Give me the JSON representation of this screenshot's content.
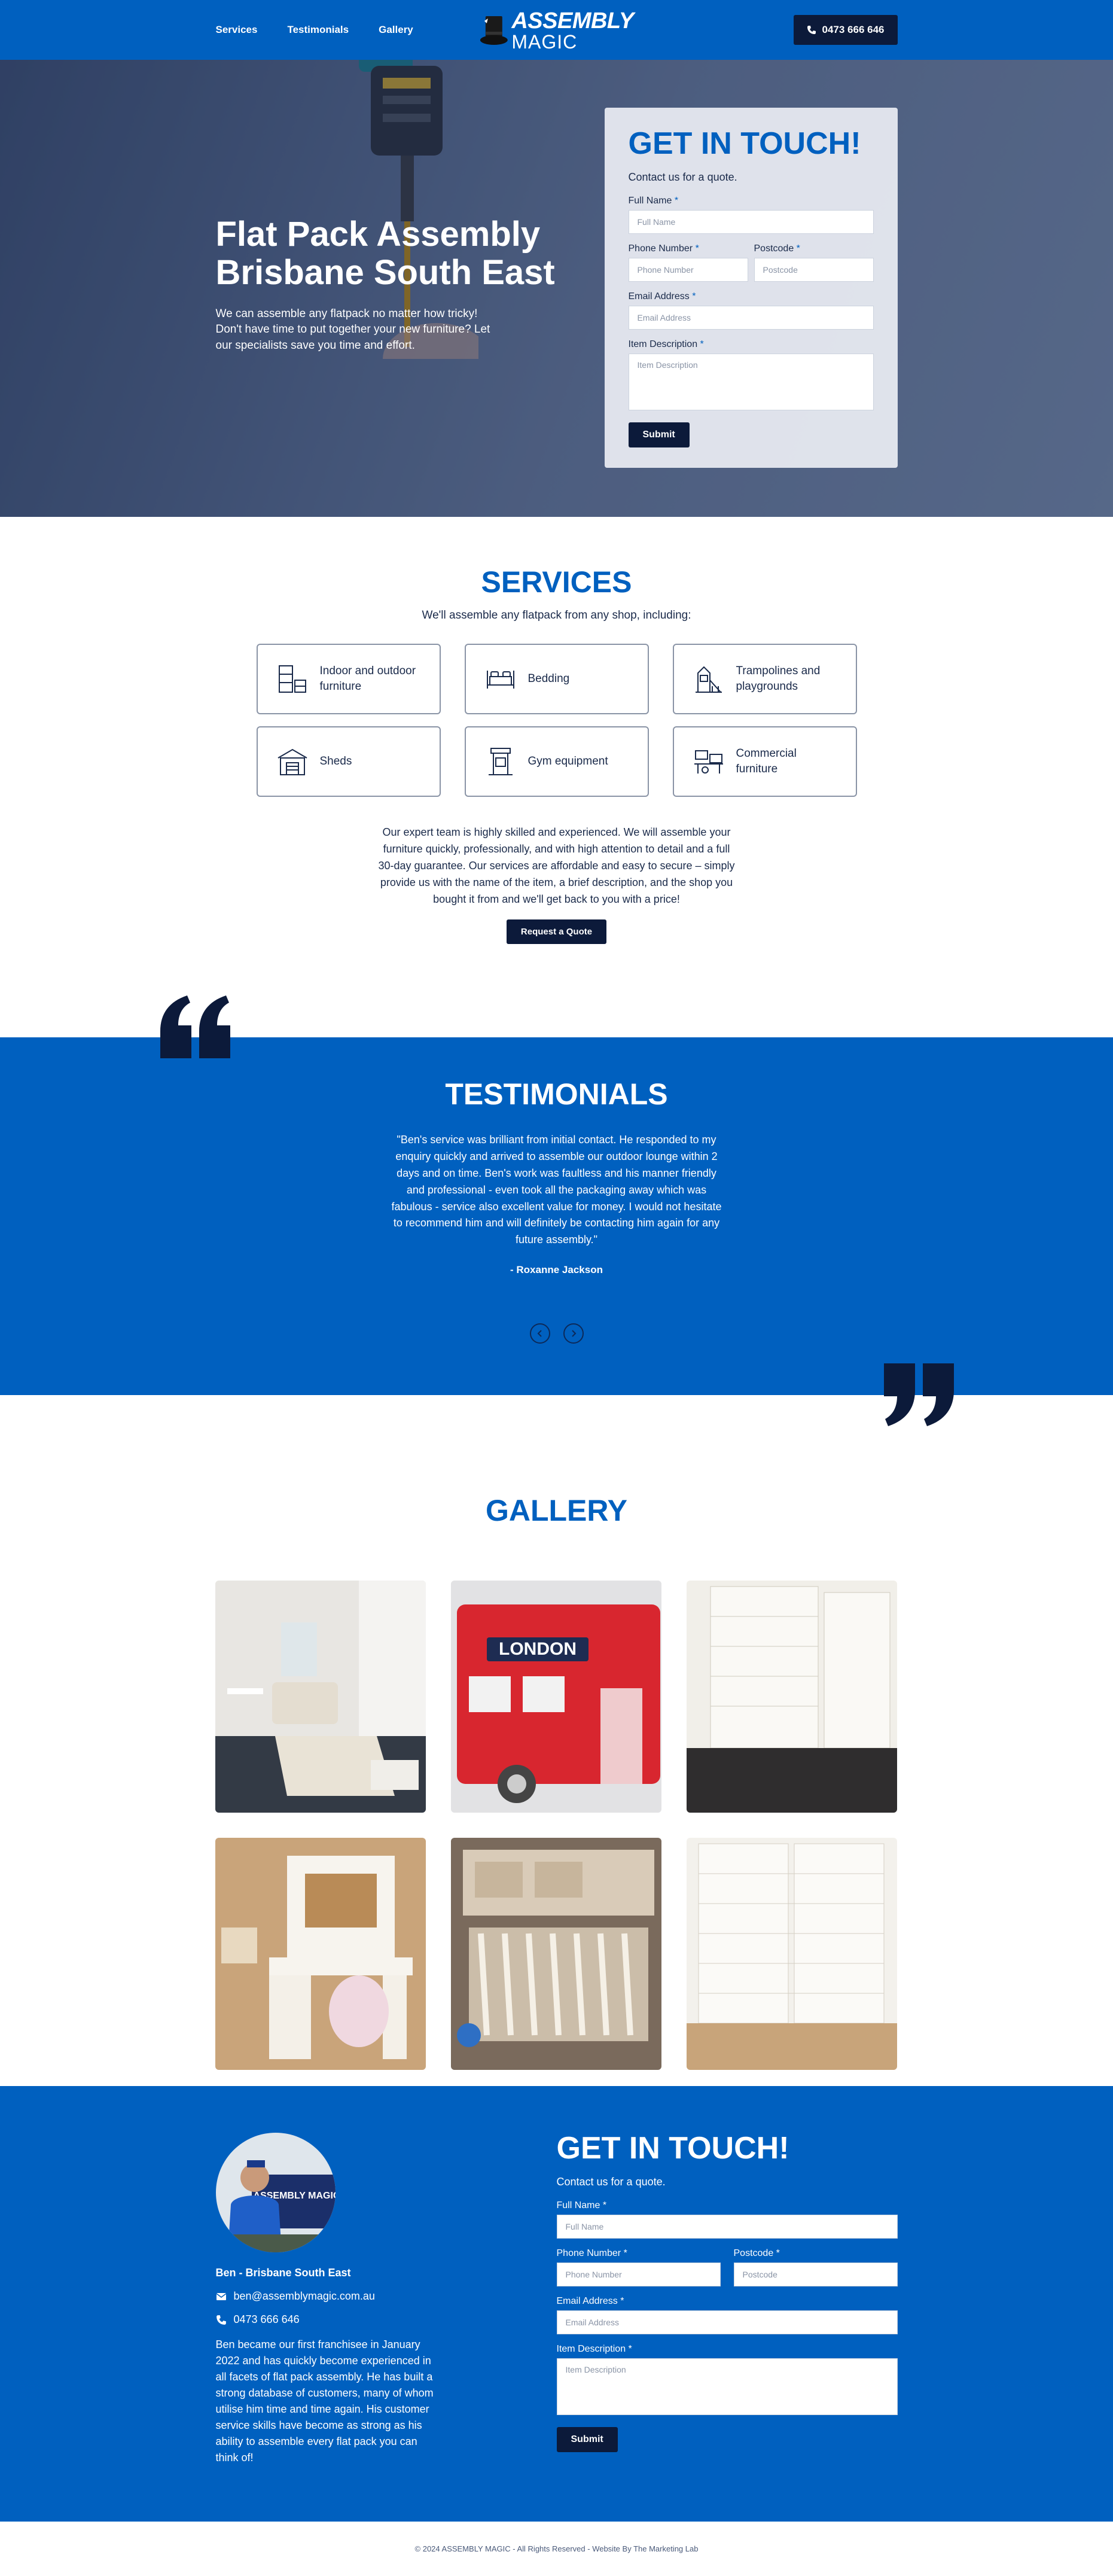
{
  "header": {
    "nav": [
      "Services",
      "Testimonials",
      "Gallery"
    ],
    "logo_line1": "ASSEMBLY",
    "logo_line2": "MAGIC",
    "phone": "0473 666 646"
  },
  "hero": {
    "title_line1": "Flat Pack Assembly",
    "title_line2": "Brisbane South East",
    "desc": "We can assemble any flatpack no matter how tricky! Don't have time to put together your new furniture? Let our specialists save you time and effort."
  },
  "form": {
    "title": "GET IN TOUCH!",
    "subtitle": "Contact us for a quote.",
    "full_name_label": "Full Name",
    "full_name_placeholder": "Full Name",
    "phone_label": "Phone Number",
    "phone_placeholder": "Phone Number",
    "postcode_label": "Postcode",
    "postcode_placeholder": "Postcode",
    "email_label": "Email Address",
    "email_placeholder": "Email Address",
    "item_label": "Item Description",
    "item_placeholder": "Item Description",
    "required_mark": "*",
    "submit": "Submit"
  },
  "services": {
    "title": "SERVICES",
    "subtitle": "We'll assemble any flatpack from any shop, including:",
    "items": [
      {
        "label": "Indoor and outdoor furniture",
        "icon": "furniture-icon"
      },
      {
        "label": "Bedding",
        "icon": "bed-icon"
      },
      {
        "label": "Trampolines and playgrounds",
        "icon": "playground-icon"
      },
      {
        "label": "Sheds",
        "icon": "shed-icon"
      },
      {
        "label": "Gym equipment",
        "icon": "gym-icon"
      },
      {
        "label": "Commercial furniture",
        "icon": "commercial-icon"
      }
    ],
    "body": "Our expert team is highly skilled and experienced. We will assemble your furniture quickly, professionally, and with high attention to detail and a full 30-day guarantee. Our services are affordable and easy to secure – simply provide us with the name of the item, a brief description, and the shop you bought it from and we'll get back to you with a price!",
    "cta": "Request a Quote"
  },
  "testimonials": {
    "title": "TESTIMONIALS",
    "quote": "\"Ben's service was brilliant from initial contact. He responded to my enquiry quickly and arrived to assemble our outdoor lounge within 2 days and on time. Ben's work was faultless and his manner friendly and professional - even took all the packaging away which was fabulous - service also excellent value for money. I would not hesitate to recommend him and will definitely be contacting him again for any future assembly.\"",
    "author": "- Roxanne Jackson"
  },
  "gallery": {
    "title": "GALLERY",
    "bus_sign": "LONDON"
  },
  "contact": {
    "van_text": "ASSEMBLY MAGIC",
    "name": "Ben - Brisbane South East",
    "email": "ben@assemblymagic.com.au",
    "phone": "0473 666 646",
    "bio": "Ben became our first franchisee in January 2022 and has quickly become experienced in all facets of flat pack assembly. He has built a strong database of customers, many of whom utilise him time and time again. His customer service skills have become as strong as his ability to assemble every flat pack you can think of!"
  },
  "footer": {
    "copyright": "© 2024 ASSEMBLY MAGIC - All Rights Reserved - Website By The Marketing Lab"
  },
  "colors": {
    "brand_blue": "#0060bf",
    "navy": "#0c1a3a"
  }
}
